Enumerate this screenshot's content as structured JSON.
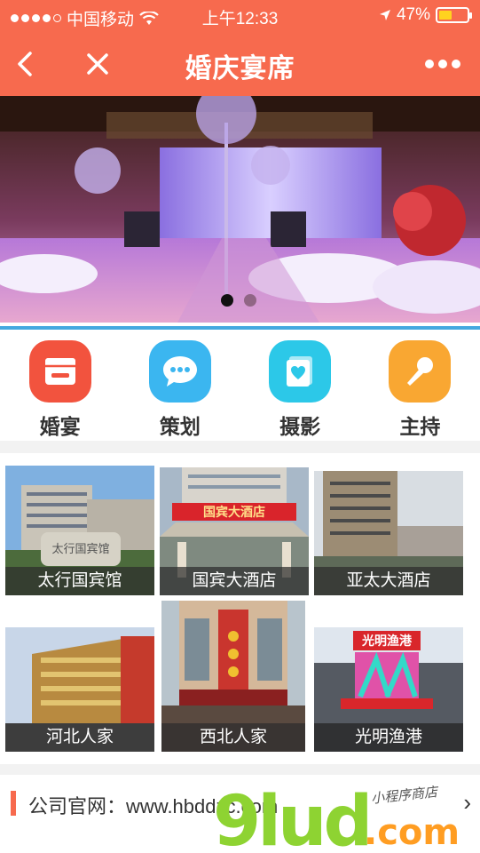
{
  "status_bar": {
    "carrier": "中国移动",
    "time": "上午12:33",
    "battery_percent": "47%",
    "battery_level": 0.47,
    "signal_bars": 4
  },
  "nav": {
    "title": "婚庆宴席",
    "back_icon": "chevron-left-icon",
    "close_icon": "close-icon",
    "more_icon": "more-dots-icon"
  },
  "banner": {
    "slide_count": 2,
    "active_slide": 1
  },
  "categories": [
    {
      "label": "婚宴",
      "icon": "storefront-icon",
      "color": "#f2533e"
    },
    {
      "label": "策划",
      "icon": "chat-bubble-icon",
      "color": "#3bb6f0"
    },
    {
      "label": "摄影",
      "icon": "photo-album-icon",
      "color": "#2cc8e8"
    },
    {
      "label": "主持",
      "icon": "microphone-icon",
      "color": "#f9a732"
    }
  ],
  "hotels": [
    {
      "name": "太行国宾馆"
    },
    {
      "name": "国宾大酒店"
    },
    {
      "name": "亚太大酒店"
    },
    {
      "name": "河北人家"
    },
    {
      "name": "西北人家"
    },
    {
      "name": "光明渔港"
    }
  ],
  "footer": {
    "text": "公司官网：www.hbddzc.com",
    "arrow": "chevron-right-icon"
  },
  "watermark": {
    "brand": "9lud",
    "domain": ".com",
    "tagline": "小程序商店"
  },
  "colors": {
    "accent": "#f76a4e",
    "divider": "#45a8e0"
  }
}
